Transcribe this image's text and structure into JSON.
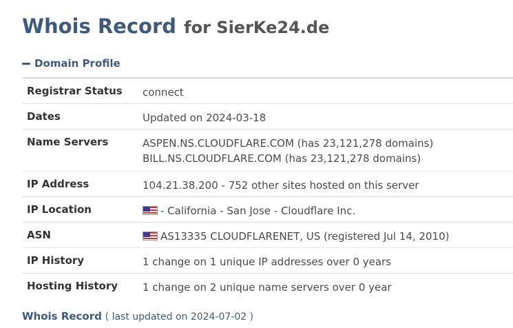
{
  "header": {
    "title": "Whois Record",
    "subtitle": "for SierKe24.de"
  },
  "section": {
    "title": "Domain Profile",
    "icon": "minus-icon"
  },
  "rows": [
    {
      "label": "Registrar Status",
      "value": "connect"
    },
    {
      "label": "Dates",
      "value": "Updated on 2024-03-18"
    },
    {
      "label": "Name Servers",
      "lines": [
        "ASPEN.NS.CLOUDFLARE.COM (has 23,121,278 domains)",
        "BILL.NS.CLOUDFLARE.COM (has 23,121,278 domains)"
      ]
    },
    {
      "label": "IP Address",
      "value": "104.21.38.200 - 752 other sites hosted on this server"
    },
    {
      "label": "IP Location",
      "value": "- California - San Jose - Cloudflare Inc.",
      "icon": "us-flag-icon"
    },
    {
      "label": "ASN",
      "value": "AS13335 CLOUDFLARENET, US (registered Jul 14, 2010)",
      "icon": "us-flag-icon"
    },
    {
      "label": "IP History",
      "value": "1 change on 1 unique IP addresses over 0 years"
    },
    {
      "label": "Hosting History",
      "value": "1 change on 2 unique name servers over 0 year"
    }
  ],
  "footer": {
    "link": "Whois Record",
    "note": "( last updated on 2024-07-02 )"
  },
  "colors": {
    "heading": "#3f5a7d",
    "text": "#4a4a4a",
    "border": "#e2e2e2"
  }
}
